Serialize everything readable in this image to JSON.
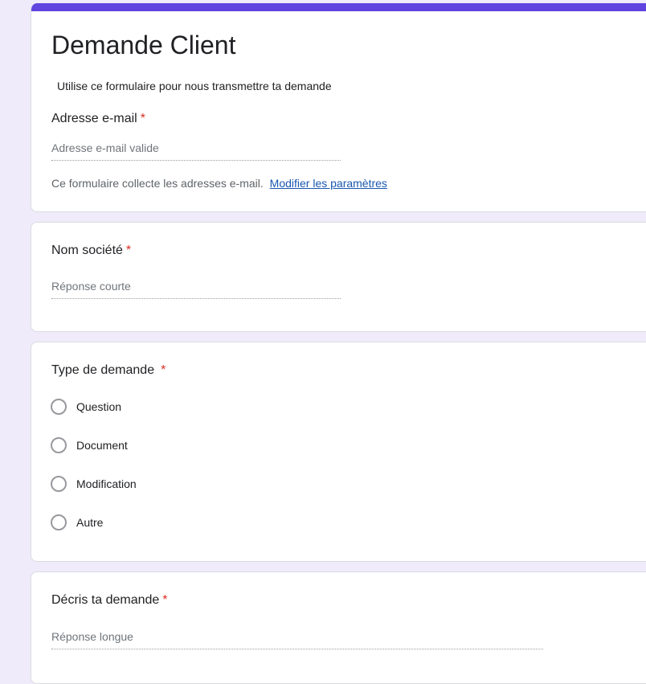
{
  "form": {
    "title": "Demande Client",
    "description": "Utilise ce formulaire pour nous transmettre ta demande",
    "accent_color": "#6044e0",
    "background_color": "#efebfa"
  },
  "email_question": {
    "label": "Adresse e-mail",
    "required_mark": "*",
    "placeholder": "Adresse e-mail valide",
    "collect_note": "Ce formulaire collecte les adresses e-mail.",
    "settings_link": "Modifier les paramètres"
  },
  "company_question": {
    "label": "Nom société",
    "required_mark": "*",
    "placeholder": "Réponse courte"
  },
  "type_question": {
    "label": "Type de demande",
    "required_mark": "*",
    "options": [
      "Question",
      "Document",
      "Modification",
      "Autre"
    ]
  },
  "describe_question": {
    "label": "Décris ta demande",
    "required_mark": "*",
    "placeholder": "Réponse longue"
  }
}
